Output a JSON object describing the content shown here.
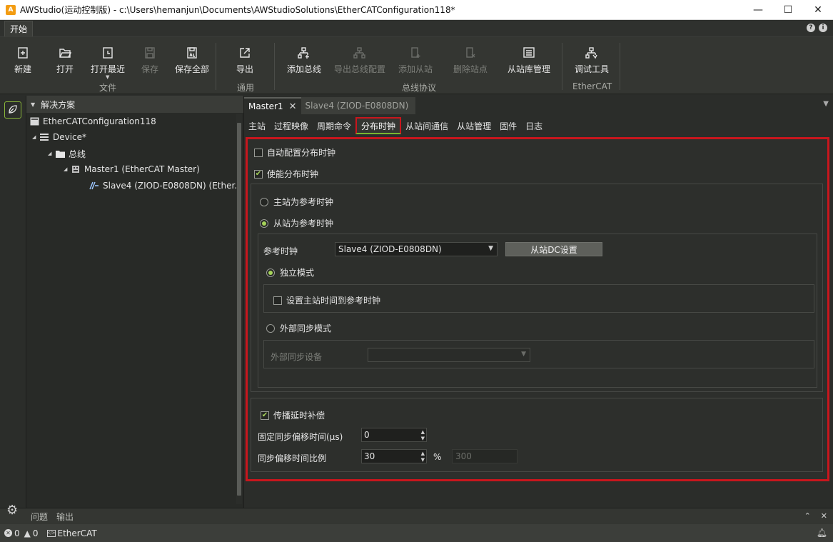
{
  "window": {
    "title": "AWStudio(运动控制版) - c:\\Users\\hemanjun\\Documents\\AWStudioSolutions\\EtherCATConfiguration118*",
    "app_icon": "aw-logo-icon",
    "minimize": "—",
    "maximize": "☐",
    "close": "✕"
  },
  "ribbon": {
    "tab_label": "开始",
    "groups": {
      "file": "文件",
      "general": "通用",
      "bus_protocol": "总线协议",
      "ethercat": "EtherCAT"
    },
    "buttons": {
      "new": "新建",
      "open": "打开",
      "open_recent": "打开最近",
      "save": "保存",
      "save_all": "保存全部",
      "export": "导出",
      "add_bus": "添加总线",
      "export_bus_config": "导出总线配置",
      "add_slave": "添加从站",
      "delete_slave": "删除站点",
      "slave_lib": "从站库管理",
      "debug_tool": "调试工具"
    }
  },
  "explorer": {
    "header": "解决方案",
    "tree": {
      "root": "EtherCATConfiguration118",
      "device": "Device*",
      "bus": "总线",
      "master": "Master1 (EtherCAT Master)",
      "slave": "Slave4 (ZIOD-E0808DN) (Ether..."
    }
  },
  "doc_tabs": {
    "active": "Master1",
    "inactive": "Slave4 (ZIOD-E0808DN)",
    "close": "✕"
  },
  "sub_tabs": [
    "主站",
    "过程映像",
    "周期命令",
    "分布时钟",
    "从站间通信",
    "从站管理",
    "固件",
    "日志"
  ],
  "dc": {
    "auto_config": {
      "label": "自动配置分布时钟",
      "checked": false
    },
    "enable_dc": {
      "label": "使能分布时钟",
      "checked": true
    },
    "master_ref": {
      "label": "主站为参考时钟",
      "selected": false
    },
    "slave_ref": {
      "label": "从站为参考时钟",
      "selected": true
    },
    "ref_clock_label": "参考时钟",
    "ref_clock_value": "Slave4 (ZIOD-E0808DN)",
    "slave_dc_button": "从站DC设置",
    "independent_mode": {
      "label": "独立模式",
      "selected": true
    },
    "set_master_time": {
      "label": "设置主站时间到参考时钟",
      "checked": false
    },
    "external_sync_mode": {
      "label": "外部同步模式",
      "selected": false
    },
    "external_sync_device_label": "外部同步设备",
    "external_sync_device_value": "",
    "propagation_comp": {
      "label": "传播延时补偿",
      "checked": true
    },
    "fixed_offset_label": "固定同步偏移时间(µs)",
    "fixed_offset_value": "0",
    "offset_ratio_label": "同步偏移时间比例",
    "offset_ratio_value": "30",
    "percent": "%",
    "computed_value": "300"
  },
  "bottom_panel": {
    "tabs": [
      "问题",
      "输出"
    ]
  },
  "statusbar": {
    "errors": "0",
    "warnings": "0",
    "mode": "EtherCAT"
  },
  "colors": {
    "highlight_red": "#c8161d",
    "check_green": "#a6d35a",
    "background": "#2b2d2a"
  }
}
